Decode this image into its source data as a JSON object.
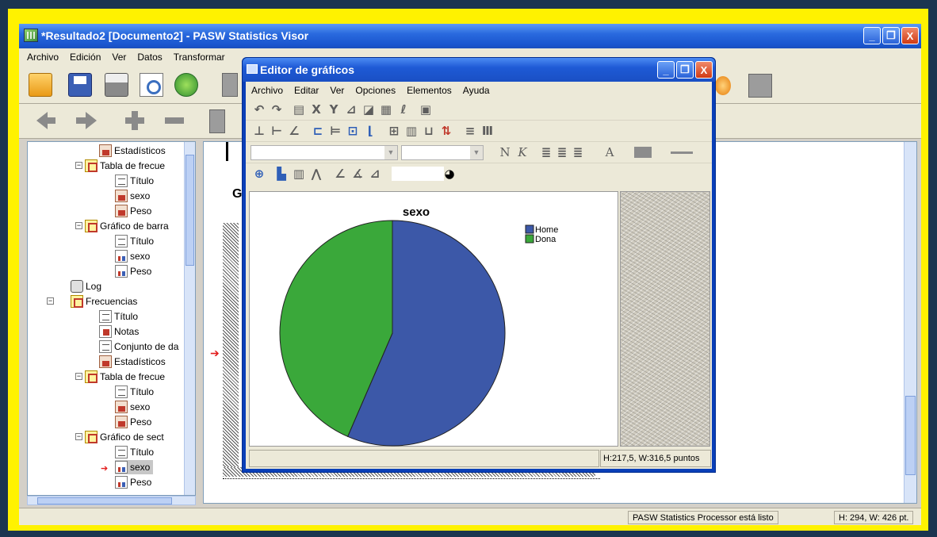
{
  "main_window": {
    "title": "*Resultado2 [Documento2] - PASW Statistics Visor",
    "menu": [
      "Archivo",
      "Edición",
      "Ver",
      "Datos",
      "Transformar"
    ],
    "controls": {
      "minimize": "_",
      "restore": "❐",
      "close": "X"
    }
  },
  "tree": {
    "items": [
      {
        "label": "Estadísticos",
        "icon": "statistics-icon"
      },
      {
        "label": "Tabla de frecue",
        "icon": "table-icon"
      },
      {
        "label": "Título",
        "icon": "title-icon"
      },
      {
        "label": "sexo",
        "icon": "statistics-icon"
      },
      {
        "label": "Peso",
        "icon": "statistics-icon"
      },
      {
        "label": "Gráfico de barra",
        "icon": "table-icon"
      },
      {
        "label": "Título",
        "icon": "title-icon"
      },
      {
        "label": "sexo",
        "icon": "chart-icon"
      },
      {
        "label": "Peso",
        "icon": "chart-icon"
      },
      {
        "label": "Log",
        "icon": "log-icon"
      },
      {
        "label": "Frecuencias",
        "icon": "table-icon"
      },
      {
        "label": "Título",
        "icon": "title-icon"
      },
      {
        "label": "Notas",
        "icon": "notes-icon"
      },
      {
        "label": "Conjunto de da",
        "icon": "title-icon"
      },
      {
        "label": "Estadísticos",
        "icon": "statistics-icon"
      },
      {
        "label": "Tabla de frecue",
        "icon": "table-icon"
      },
      {
        "label": "Título",
        "icon": "title-icon"
      },
      {
        "label": "sexo",
        "icon": "statistics-icon"
      },
      {
        "label": "Peso",
        "icon": "statistics-icon"
      },
      {
        "label": "Gráfico de sect",
        "icon": "table-icon"
      },
      {
        "label": "Título",
        "icon": "title-icon"
      },
      {
        "label": "sexo",
        "icon": "chart-icon"
      },
      {
        "label": "Peso",
        "icon": "chart-icon"
      }
    ],
    "selected_item": "sexo"
  },
  "content": {
    "heading_fragment": "G"
  },
  "status_bar": {
    "processor": "PASW Statistics Processor está listo",
    "size": "H: 294, W: 426 pt."
  },
  "chart_editor": {
    "title": "Editor de gráficos",
    "menu": [
      "Archivo",
      "Editar",
      "Ver",
      "Opciones",
      "Elementos",
      "Ayuda"
    ],
    "font_buttons": {
      "normal": "N",
      "italic": "K"
    },
    "text_color_label": "A",
    "status": "H:217,5, W:316,5 puntos"
  },
  "chart_data": {
    "type": "pie",
    "title": "sexo",
    "categories": [
      "Home",
      "Dona"
    ],
    "values": [
      56.5,
      43.5
    ],
    "colors": [
      "#3c58a8",
      "#3aa83a"
    ],
    "legend_position": "top-right"
  },
  "colors": {
    "desktop": "#1b3550",
    "frame": "#fff200",
    "titlebar": "#2a6ade"
  }
}
